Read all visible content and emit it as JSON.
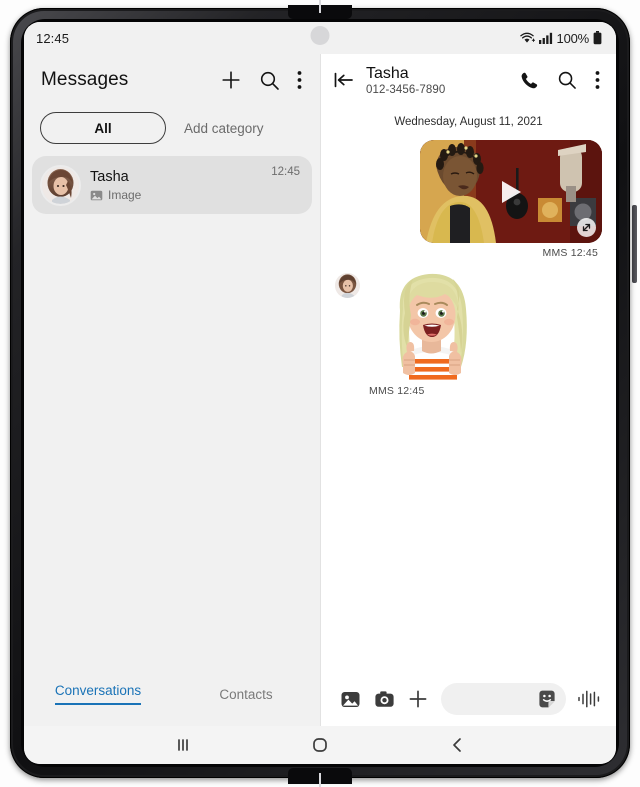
{
  "status_bar": {
    "time": "12:45",
    "battery_percent": "100%",
    "wifi_icon": "wifi-icon",
    "signal_icon": "signal-bars-icon",
    "battery_icon": "battery-icon",
    "camera_icon": "front-camera-dot"
  },
  "left_pane": {
    "title": "Messages",
    "icons": {
      "compose": "plus-icon",
      "search": "search-icon",
      "more": "overflow-menu-icon"
    },
    "chips": {
      "all_label": "All",
      "add_category_label": "Add category"
    },
    "conversations": [
      {
        "name": "Tasha",
        "preview": "Image",
        "preview_icon": "image-icon",
        "time": "12:45",
        "avatar": "contact-photo-tasha",
        "selected": true
      }
    ],
    "tabs": [
      {
        "label": "Conversations",
        "active": true
      },
      {
        "label": "Contacts",
        "active": false
      }
    ]
  },
  "right_pane": {
    "back_icon": "back-to-start-icon",
    "contact_name": "Tasha",
    "contact_number": "012-3456-7890",
    "icons": {
      "call": "phone-icon",
      "search": "search-icon",
      "more": "overflow-menu-icon"
    },
    "date_separator": "Wednesday, August 11, 2021",
    "messages": [
      {
        "type": "video",
        "direction": "outgoing",
        "meta": "MMS  12:45",
        "play_icon": "play-icon",
        "expand_icon": "expand-icon",
        "description": "video-thumbnail-studio-singer"
      },
      {
        "type": "sticker",
        "direction": "incoming",
        "meta": "MMS  12:45",
        "avatar": "contact-photo-tasha",
        "description": "ar-emoji-thumbs-up-sticker"
      }
    ],
    "composer": {
      "gallery_icon": "gallery-icon",
      "camera_icon": "camera-icon",
      "add_icon": "plus-icon",
      "input_value": "",
      "input_placeholder": "",
      "sticker_icon": "sticker-icon",
      "voice_icon": "voice-waveform-icon"
    }
  },
  "nav_bar": {
    "recents": "recents-icon",
    "home": "home-icon",
    "back": "back-icon"
  },
  "colors": {
    "accent": "#1a73b7",
    "left_bg": "#f1f1f1",
    "right_bg": "#ffffff",
    "selected_row": "#e0e0e0"
  }
}
